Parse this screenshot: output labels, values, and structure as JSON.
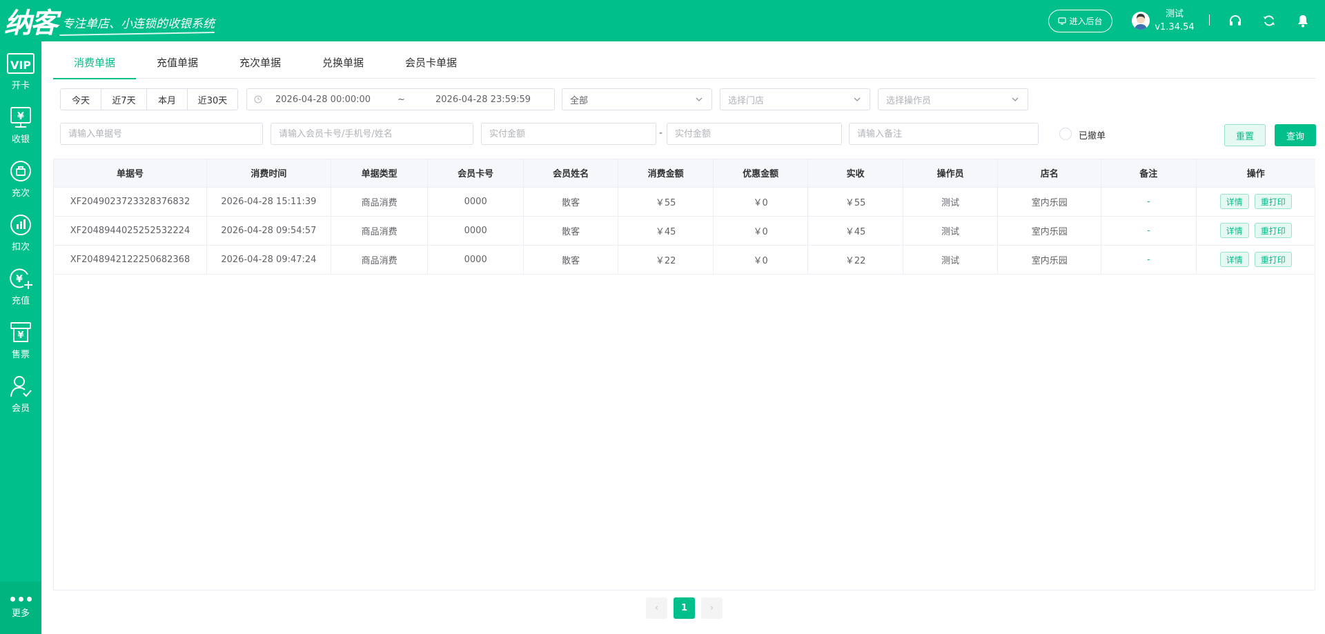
{
  "header": {
    "logo_main": "纳客",
    "logo_slogan": "专注单店、小连锁的收银系统",
    "backend_button": "进入后台",
    "user_name": "测试",
    "version": "v1.34.54",
    "icons": [
      "headset-icon",
      "refresh-icon",
      "bell-icon"
    ]
  },
  "sidebar": {
    "items": [
      {
        "label": "开卡",
        "icon": "vip-card-icon"
      },
      {
        "label": "收银",
        "icon": "cashier-icon"
      },
      {
        "label": "充次",
        "icon": "recharge-times-icon"
      },
      {
        "label": "扣次",
        "icon": "deduct-times-icon"
      },
      {
        "label": "充值",
        "icon": "recharge-icon"
      },
      {
        "label": "售票",
        "icon": "ticket-icon"
      },
      {
        "label": "会员",
        "icon": "member-icon"
      }
    ],
    "more": "更多"
  },
  "tabs": [
    "消费单据",
    "充值单据",
    "充次单据",
    "兑换单据",
    "会员卡单据"
  ],
  "active_tab": "消费单据",
  "filters": {
    "quick": [
      "今天",
      "近7天",
      "本月",
      "近30天"
    ],
    "date_start": "2026-04-28 00:00:00",
    "date_sep": "~",
    "date_end": "2026-04-28 23:59:59",
    "type_value": "全部",
    "store_placeholder": "选择门店",
    "operator_placeholder": "选择操作员",
    "order_placeholder": "请输入单据号",
    "member_placeholder": "请输入会员卡号/手机号/姓名",
    "amount_min_placeholder": "实付金额",
    "amount_sep": "-",
    "amount_max_placeholder": "实付金额",
    "remark_placeholder": "请输入备注",
    "cancelled_label": "已撤单",
    "reset": "重置",
    "query": "查询"
  },
  "table": {
    "columns": [
      "单据号",
      "消费时间",
      "单据类型",
      "会员卡号",
      "会员姓名",
      "消费金额",
      "优惠金额",
      "实收",
      "操作员",
      "店名",
      "备注",
      "操作"
    ],
    "rows": [
      [
        "XF2049023723328376832",
        "2026-04-28 15:11:39",
        "商品消费",
        "0000",
        "散客",
        "￥55",
        "￥0",
        "￥55",
        "测试",
        "室内乐园",
        "-"
      ],
      [
        "XF2048944025252532224",
        "2026-04-28 09:54:57",
        "商品消费",
        "0000",
        "散客",
        "￥45",
        "￥0",
        "￥45",
        "测试",
        "室内乐园",
        "-"
      ],
      [
        "XF2048942122250682368",
        "2026-04-28 09:47:24",
        "商品消费",
        "0000",
        "散客",
        "￥22",
        "￥0",
        "￥22",
        "测试",
        "室内乐园",
        "-"
      ]
    ],
    "actions": [
      "详情",
      "重打印"
    ]
  },
  "pagination": {
    "prev": "‹",
    "current": "1",
    "next": "›"
  }
}
